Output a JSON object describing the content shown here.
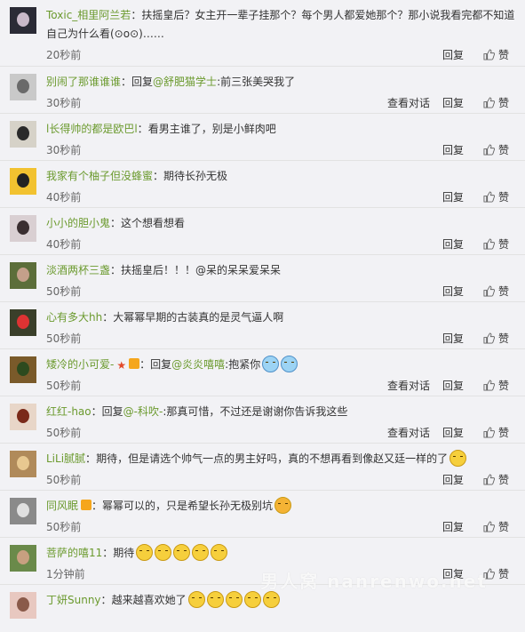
{
  "labels": {
    "reply": "回复",
    "view_conversation": "查看对话",
    "like": "赞",
    "colon": "：",
    "reply_prefix": "回复"
  },
  "comments": [
    {
      "author": "Toxic_相里阿兰若",
      "reply_to": "",
      "text": "扶摇皇后？女主开一辈子挂那个？每个男人都爱她那个？那小说我看完都不知道自己为什么看(⊙o⊙)……",
      "time": "20秒前",
      "view_conversation": false,
      "emojis": [],
      "badges": []
    },
    {
      "author": "别闹了那谁谁谁",
      "reply_to": "@舒肥猫学士",
      "text": ":前三张美哭我了",
      "time": "30秒前",
      "view_conversation": true,
      "emojis": [],
      "badges": []
    },
    {
      "author": "l长得帅的都是欧巴l",
      "reply_to": "",
      "text": "看男主谁了，别是小鲜肉吧",
      "time": "30秒前",
      "view_conversation": false,
      "emojis": [],
      "badges": []
    },
    {
      "author": "我家有个柚子但没蜂蜜",
      "reply_to": "",
      "text": "期待长孙无极",
      "time": "40秒前",
      "view_conversation": false,
      "emojis": [],
      "badges": []
    },
    {
      "author": "小小的胆小鬼",
      "reply_to": "",
      "text": "这个想看想看",
      "time": "40秒前",
      "view_conversation": false,
      "emojis": [],
      "badges": []
    },
    {
      "author": "淡酒两杯三盏",
      "reply_to": "",
      "text": "扶摇皇后！！！@呆的呆呆爱呆呆",
      "time": "50秒前",
      "view_conversation": false,
      "emojis": [],
      "badges": []
    },
    {
      "author": "心有多大hh",
      "reply_to": "",
      "text": "大幂幂早期的古装真的是灵气逼人啊",
      "time": "50秒前",
      "view_conversation": false,
      "emojis": [],
      "badges": []
    },
    {
      "author": "矮冷的小可爱-",
      "reply_to": "@炎炎嘻嘻",
      "text": ":抱紧你",
      "time": "50秒前",
      "view_conversation": true,
      "emojis": [
        "cry-emoji",
        "cry-emoji"
      ],
      "badges": [
        "star-badge",
        "member-badge"
      ]
    },
    {
      "author": "红红-hao",
      "reply_to": "@-科吹-",
      "text": ":那真可惜，不过还是谢谢你告诉我这些",
      "time": "50秒前",
      "view_conversation": true,
      "emojis": [],
      "badges": []
    },
    {
      "author": "LiLi腻腻",
      "reply_to": "",
      "text": "期待，但是请选个帅气一点的男主好吗，真的不想再看到像赵又廷一样的了",
      "time": "50秒前",
      "view_conversation": false,
      "emojis": [
        "smile-emoji"
      ],
      "badges": []
    },
    {
      "author": "同风眠",
      "reply_to": "",
      "text": "幂幂可以的，只是希望长孙无极别坑",
      "time": "50秒前",
      "view_conversation": false,
      "emojis": [
        "angry-emoji"
      ],
      "badges": [
        "member-badge"
      ]
    },
    {
      "author": "菩萨的嘻11",
      "reply_to": "",
      "text": "期待",
      "time": "1分钟前",
      "view_conversation": false,
      "emojis": [
        "smirk-emoji",
        "smirk-emoji",
        "smirk-emoji",
        "smirk-emoji",
        "smirk-emoji"
      ],
      "badges": []
    },
    {
      "author": "丁妍Sunny",
      "reply_to": "",
      "text": "越来越喜欢她了",
      "time": "",
      "view_conversation": false,
      "emojis": [
        "smirk-emoji",
        "smirk-emoji",
        "smirk-emoji",
        "smirk-emoji",
        "smirk-emoji"
      ],
      "badges": []
    }
  ],
  "watermark": "男人窝 nanrenwo.net",
  "colors": {
    "author": "#6b9a2e",
    "background": "#f2f2f5",
    "divider": "#e2e2e2"
  }
}
